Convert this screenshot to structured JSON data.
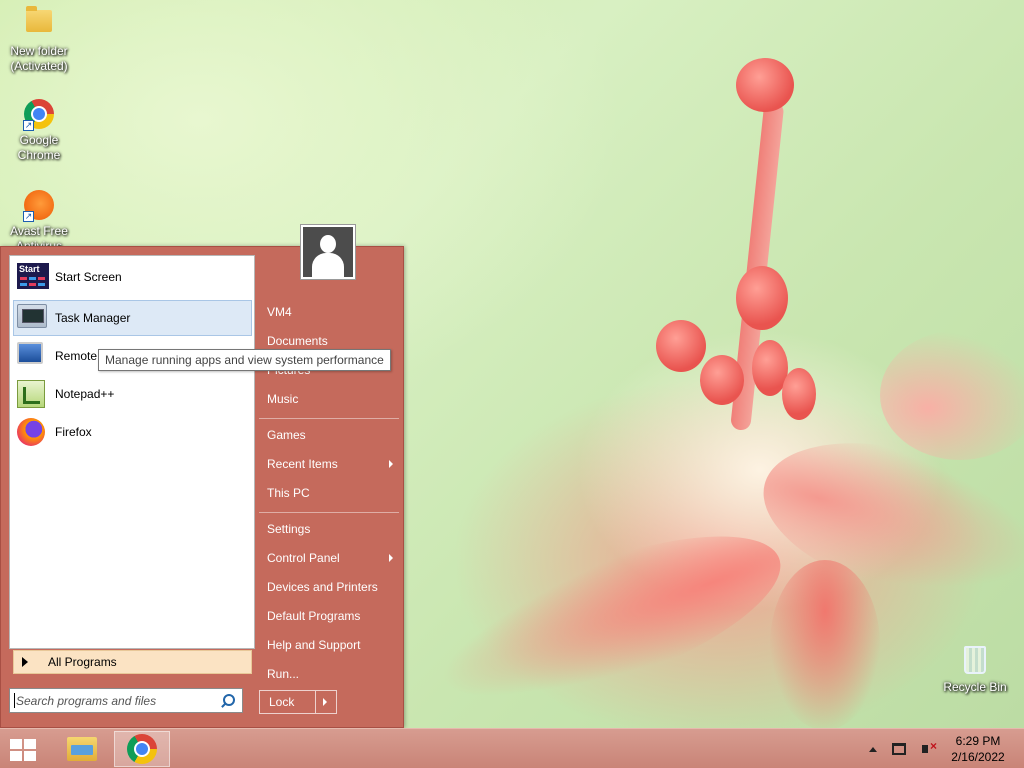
{
  "desktop": {
    "icons": [
      {
        "label_line1": "New folder",
        "label_line2": "(Activated)"
      },
      {
        "label_line1": "Google",
        "label_line2": "Chrome"
      },
      {
        "label_line1": "Avast Free",
        "label_line2": "Antivirus"
      },
      {
        "label_line1": "Recycle Bin",
        "label_line2": ""
      }
    ]
  },
  "start_menu": {
    "programs": [
      {
        "label": "Start Screen",
        "icon": "start-screen-icon"
      },
      {
        "label": "Task Manager",
        "icon": "task-manager-icon"
      },
      {
        "label": "Remote D",
        "icon": "remote-desktop-icon"
      },
      {
        "label": "Notepad++",
        "icon": "notepad-plus-plus-icon"
      },
      {
        "label": "Firefox",
        "icon": "firefox-icon"
      }
    ],
    "start_screen_icon_text": "Start",
    "all_programs_label": "All Programs",
    "search_placeholder": "Search programs and files",
    "tooltip": "Manage running apps and view system performance",
    "right_links": [
      {
        "label": "VM4"
      },
      {
        "label": "Documents"
      },
      {
        "label": "Pictures"
      },
      {
        "label": "Music"
      },
      {
        "label": "Games"
      },
      {
        "label": "Recent Items",
        "has_submenu": true
      },
      {
        "label": "This PC"
      },
      {
        "label": "Settings"
      },
      {
        "label": "Control Panel",
        "has_submenu": true
      },
      {
        "label": "Devices and Printers"
      },
      {
        "label": "Default Programs"
      },
      {
        "label": "Help and Support"
      },
      {
        "label": "Run..."
      }
    ],
    "lock_label": "Lock",
    "accent_color": "#c56a5c"
  },
  "taskbar": {
    "items": [
      {
        "icon": "file-explorer-icon",
        "active": false
      },
      {
        "icon": "chrome-icon",
        "active": true
      }
    ],
    "clock_time": "6:29 PM",
    "clock_date": "2/16/2022"
  }
}
